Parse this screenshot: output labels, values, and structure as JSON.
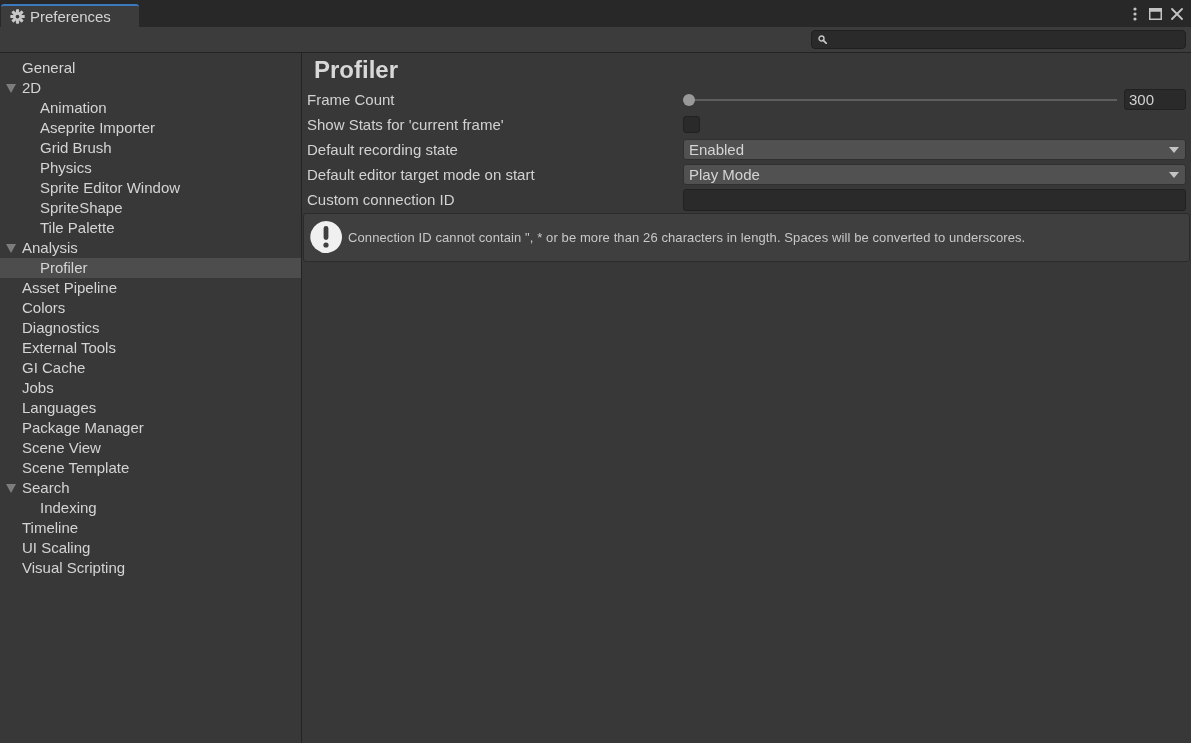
{
  "window": {
    "tab": {
      "title": "Preferences",
      "selected": true
    }
  },
  "sidebar": {
    "items": [
      {
        "label": "General",
        "selected": false
      },
      {
        "label": "2D",
        "selected": false,
        "expanded": true,
        "children": [
          {
            "label": "Animation",
            "selected": false
          },
          {
            "label": "Aseprite Importer",
            "selected": false
          },
          {
            "label": "Grid Brush",
            "selected": false
          },
          {
            "label": "Physics",
            "selected": false
          },
          {
            "label": "Sprite Editor Window",
            "selected": false
          },
          {
            "label": "SpriteShape",
            "selected": false
          },
          {
            "label": "Tile Palette",
            "selected": false
          }
        ]
      },
      {
        "label": "Analysis",
        "selected": false,
        "expanded": true,
        "children": [
          {
            "label": "Profiler",
            "selected": true
          }
        ]
      },
      {
        "label": "Asset Pipeline",
        "selected": false
      },
      {
        "label": "Colors",
        "selected": false
      },
      {
        "label": "Diagnostics",
        "selected": false
      },
      {
        "label": "External Tools",
        "selected": false
      },
      {
        "label": "GI Cache",
        "selected": false
      },
      {
        "label": "Jobs",
        "selected": false
      },
      {
        "label": "Languages",
        "selected": false
      },
      {
        "label": "Package Manager",
        "selected": false
      },
      {
        "label": "Scene View",
        "selected": false
      },
      {
        "label": "Scene Template",
        "selected": false
      },
      {
        "label": "Search",
        "selected": false,
        "expanded": true,
        "children": [
          {
            "label": "Indexing",
            "selected": false
          }
        ]
      },
      {
        "label": "Timeline",
        "selected": false
      },
      {
        "label": "UI Scaling",
        "selected": false
      },
      {
        "label": "Visual Scripting",
        "selected": false
      }
    ]
  },
  "page": {
    "title": "Profiler",
    "settings": [
      {
        "kind": "slider",
        "label": "Frame Count",
        "level": 0,
        "value": "300"
      },
      {
        "kind": "checkbox",
        "label": "Show Stats for 'current frame'",
        "checked": false
      },
      {
        "kind": "dropdown",
        "label": "Default recording state",
        "value": "Enabled"
      },
      {
        "kind": "dropdown",
        "label": "Default editor target mode on start",
        "value": "Play Mode"
      },
      {
        "kind": "text",
        "label": "Custom connection ID"
      }
    ],
    "info": {
      "message": "Connection ID cannot contain \", * or be more than 26 characters in length. Spaces will be converted to underscores."
    }
  }
}
